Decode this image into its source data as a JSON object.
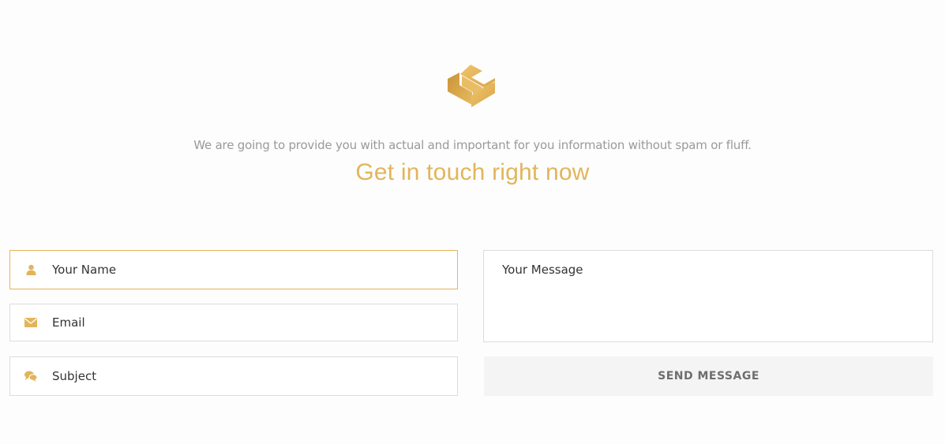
{
  "logo": {
    "icon": "brand-logo-icon",
    "color": "#e2b55b"
  },
  "intro": {
    "tagline": "We are going to provide you with actual and important for you information without spam or fluff.",
    "heading": "Get in touch right now"
  },
  "form": {
    "name": {
      "placeholder": "Your Name",
      "icon": "user-icon"
    },
    "email": {
      "placeholder": "Email",
      "icon": "envelope-icon"
    },
    "subject": {
      "placeholder": "Subject",
      "icon": "comments-icon"
    },
    "message": {
      "placeholder": "Your Message"
    },
    "send_label": "SEND MESSAGE"
  },
  "colors": {
    "accent": "#e2b55b",
    "text_muted": "#9a9a9a",
    "border": "#dcdcdc",
    "button_bg": "#f4f4f4"
  }
}
